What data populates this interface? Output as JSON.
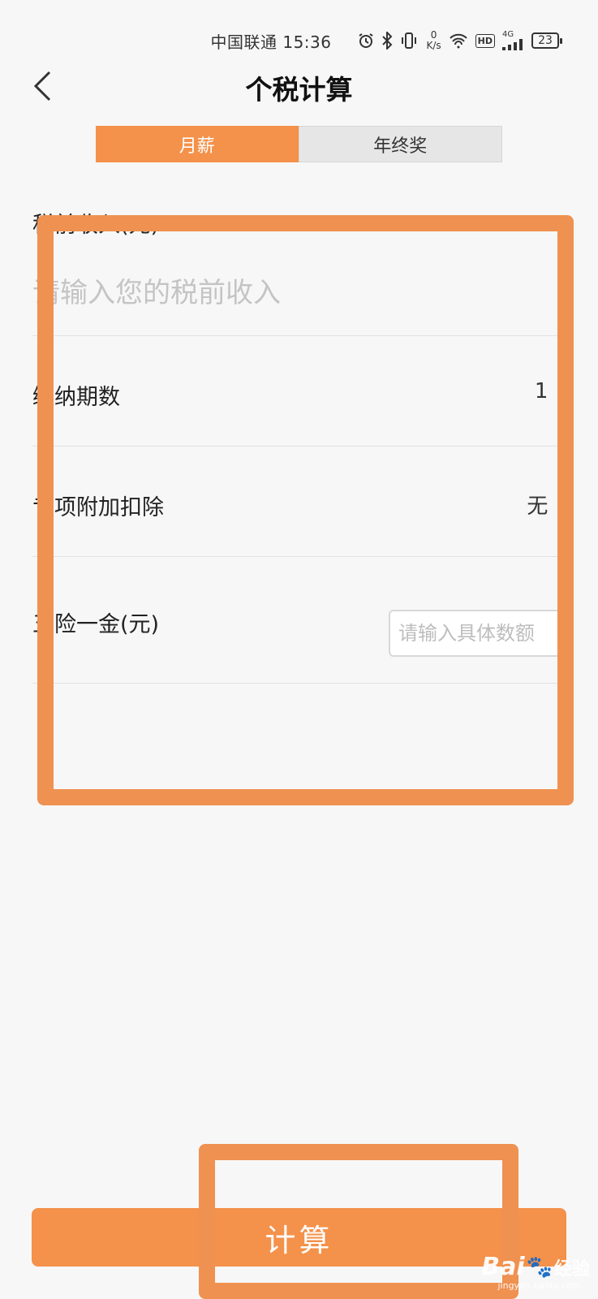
{
  "status_bar": {
    "carrier": "中国联通",
    "time": "15:36",
    "net_speed_value": "0",
    "net_speed_unit": "K/s",
    "hd_label": "HD",
    "network_type": "4G",
    "battery": "23",
    "icons": [
      "alarm-icon",
      "bluetooth-icon",
      "vibrate-icon",
      "wifi-icon",
      "hd-icon",
      "signal-icon",
      "battery-icon"
    ]
  },
  "header": {
    "title": "个税计算",
    "back_icon": "chevron-left-icon"
  },
  "tabs": [
    {
      "label": "月薪",
      "active": true
    },
    {
      "label": "年终奖",
      "active": false
    }
  ],
  "form": {
    "income": {
      "label": "税前收入(元)",
      "value": "",
      "placeholder": "请输入您的税前收入"
    },
    "periods": {
      "label": "缴纳期数",
      "value": "1"
    },
    "special_deduction": {
      "label": "专项附加扣除",
      "value": "无"
    },
    "social_fund": {
      "label": "五险一金(元)",
      "value": "",
      "placeholder": "请输入具体数额"
    }
  },
  "actions": {
    "calculate_label": "计算"
  },
  "watermark": {
    "brand": "Bai",
    "paw": "🐾",
    "brand_sub": "经验",
    "url": "jingyan.baidu.com"
  },
  "colors": {
    "accent": "#f4914a",
    "annotation": "#ef9150",
    "background": "#f7f7f7"
  }
}
